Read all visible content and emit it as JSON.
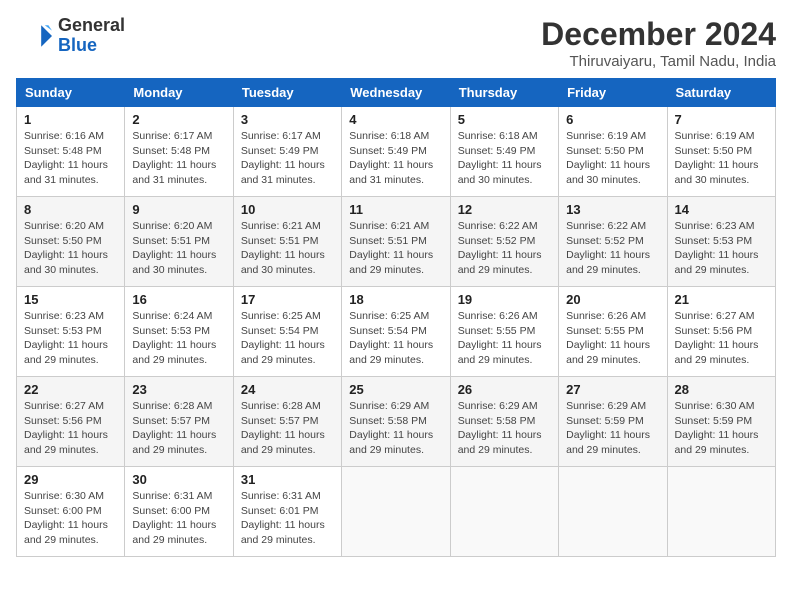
{
  "logo": {
    "general": "General",
    "blue": "Blue"
  },
  "header": {
    "month": "December 2024",
    "location": "Thiruvaiyaru, Tamil Nadu, India"
  },
  "weekdays": [
    "Sunday",
    "Monday",
    "Tuesday",
    "Wednesday",
    "Thursday",
    "Friday",
    "Saturday"
  ],
  "weeks": [
    [
      {
        "day": "1",
        "sunrise": "6:16 AM",
        "sunset": "5:48 PM",
        "daylight": "11 hours and 31 minutes."
      },
      {
        "day": "2",
        "sunrise": "6:17 AM",
        "sunset": "5:48 PM",
        "daylight": "11 hours and 31 minutes."
      },
      {
        "day": "3",
        "sunrise": "6:17 AM",
        "sunset": "5:49 PM",
        "daylight": "11 hours and 31 minutes."
      },
      {
        "day": "4",
        "sunrise": "6:18 AM",
        "sunset": "5:49 PM",
        "daylight": "11 hours and 31 minutes."
      },
      {
        "day": "5",
        "sunrise": "6:18 AM",
        "sunset": "5:49 PM",
        "daylight": "11 hours and 30 minutes."
      },
      {
        "day": "6",
        "sunrise": "6:19 AM",
        "sunset": "5:50 PM",
        "daylight": "11 hours and 30 minutes."
      },
      {
        "day": "7",
        "sunrise": "6:19 AM",
        "sunset": "5:50 PM",
        "daylight": "11 hours and 30 minutes."
      }
    ],
    [
      {
        "day": "8",
        "sunrise": "6:20 AM",
        "sunset": "5:50 PM",
        "daylight": "11 hours and 30 minutes."
      },
      {
        "day": "9",
        "sunrise": "6:20 AM",
        "sunset": "5:51 PM",
        "daylight": "11 hours and 30 minutes."
      },
      {
        "day": "10",
        "sunrise": "6:21 AM",
        "sunset": "5:51 PM",
        "daylight": "11 hours and 30 minutes."
      },
      {
        "day": "11",
        "sunrise": "6:21 AM",
        "sunset": "5:51 PM",
        "daylight": "11 hours and 29 minutes."
      },
      {
        "day": "12",
        "sunrise": "6:22 AM",
        "sunset": "5:52 PM",
        "daylight": "11 hours and 29 minutes."
      },
      {
        "day": "13",
        "sunrise": "6:22 AM",
        "sunset": "5:52 PM",
        "daylight": "11 hours and 29 minutes."
      },
      {
        "day": "14",
        "sunrise": "6:23 AM",
        "sunset": "5:53 PM",
        "daylight": "11 hours and 29 minutes."
      }
    ],
    [
      {
        "day": "15",
        "sunrise": "6:23 AM",
        "sunset": "5:53 PM",
        "daylight": "11 hours and 29 minutes."
      },
      {
        "day": "16",
        "sunrise": "6:24 AM",
        "sunset": "5:53 PM",
        "daylight": "11 hours and 29 minutes."
      },
      {
        "day": "17",
        "sunrise": "6:25 AM",
        "sunset": "5:54 PM",
        "daylight": "11 hours and 29 minutes."
      },
      {
        "day": "18",
        "sunrise": "6:25 AM",
        "sunset": "5:54 PM",
        "daylight": "11 hours and 29 minutes."
      },
      {
        "day": "19",
        "sunrise": "6:26 AM",
        "sunset": "5:55 PM",
        "daylight": "11 hours and 29 minutes."
      },
      {
        "day": "20",
        "sunrise": "6:26 AM",
        "sunset": "5:55 PM",
        "daylight": "11 hours and 29 minutes."
      },
      {
        "day": "21",
        "sunrise": "6:27 AM",
        "sunset": "5:56 PM",
        "daylight": "11 hours and 29 minutes."
      }
    ],
    [
      {
        "day": "22",
        "sunrise": "6:27 AM",
        "sunset": "5:56 PM",
        "daylight": "11 hours and 29 minutes."
      },
      {
        "day": "23",
        "sunrise": "6:28 AM",
        "sunset": "5:57 PM",
        "daylight": "11 hours and 29 minutes."
      },
      {
        "day": "24",
        "sunrise": "6:28 AM",
        "sunset": "5:57 PM",
        "daylight": "11 hours and 29 minutes."
      },
      {
        "day": "25",
        "sunrise": "6:29 AM",
        "sunset": "5:58 PM",
        "daylight": "11 hours and 29 minutes."
      },
      {
        "day": "26",
        "sunrise": "6:29 AM",
        "sunset": "5:58 PM",
        "daylight": "11 hours and 29 minutes."
      },
      {
        "day": "27",
        "sunrise": "6:29 AM",
        "sunset": "5:59 PM",
        "daylight": "11 hours and 29 minutes."
      },
      {
        "day": "28",
        "sunrise": "6:30 AM",
        "sunset": "5:59 PM",
        "daylight": "11 hours and 29 minutes."
      }
    ],
    [
      {
        "day": "29",
        "sunrise": "6:30 AM",
        "sunset": "6:00 PM",
        "daylight": "11 hours and 29 minutes."
      },
      {
        "day": "30",
        "sunrise": "6:31 AM",
        "sunset": "6:00 PM",
        "daylight": "11 hours and 29 minutes."
      },
      {
        "day": "31",
        "sunrise": "6:31 AM",
        "sunset": "6:01 PM",
        "daylight": "11 hours and 29 minutes."
      },
      null,
      null,
      null,
      null
    ]
  ],
  "labels": {
    "sunrise": "Sunrise:",
    "sunset": "Sunset:",
    "daylight": "Daylight:"
  }
}
